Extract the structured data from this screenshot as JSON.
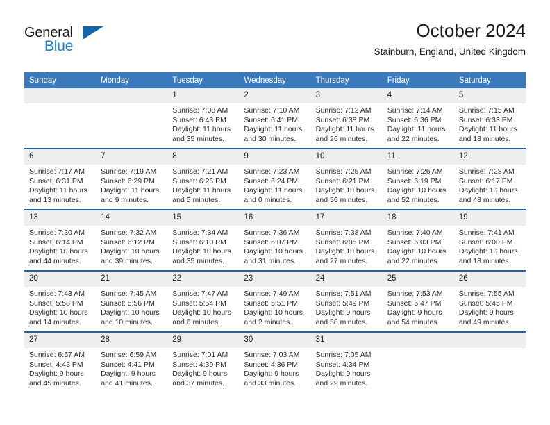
{
  "brand": {
    "name_dark": "General",
    "name_blue": "Blue",
    "accent_blue": "#1a7fd4",
    "triangle_blue": "#1565a8"
  },
  "header": {
    "title": "October 2024",
    "subtitle": "Stainburn, England, United Kingdom",
    "header_bg": "#3b79bd",
    "row_rule": "#1f63a8",
    "daynum_bg": "#eeeeee"
  },
  "weekdays": [
    "Sunday",
    "Monday",
    "Tuesday",
    "Wednesday",
    "Thursday",
    "Friday",
    "Saturday"
  ],
  "labels": {
    "sunrise_prefix": "Sunrise:",
    "sunset_prefix": "Sunset:",
    "daylight_prefix": "Daylight:"
  },
  "weeks": [
    [
      {
        "day": ""
      },
      {
        "day": ""
      },
      {
        "day": "1",
        "sunrise": "Sunrise: 7:08 AM",
        "sunset": "Sunset: 6:43 PM",
        "daylight_1": "Daylight: 11 hours",
        "daylight_2": "and 35 minutes."
      },
      {
        "day": "2",
        "sunrise": "Sunrise: 7:10 AM",
        "sunset": "Sunset: 6:41 PM",
        "daylight_1": "Daylight: 11 hours",
        "daylight_2": "and 30 minutes."
      },
      {
        "day": "3",
        "sunrise": "Sunrise: 7:12 AM",
        "sunset": "Sunset: 6:38 PM",
        "daylight_1": "Daylight: 11 hours",
        "daylight_2": "and 26 minutes."
      },
      {
        "day": "4",
        "sunrise": "Sunrise: 7:14 AM",
        "sunset": "Sunset: 6:36 PM",
        "daylight_1": "Daylight: 11 hours",
        "daylight_2": "and 22 minutes."
      },
      {
        "day": "5",
        "sunrise": "Sunrise: 7:15 AM",
        "sunset": "Sunset: 6:33 PM",
        "daylight_1": "Daylight: 11 hours",
        "daylight_2": "and 18 minutes."
      }
    ],
    [
      {
        "day": "6",
        "sunrise": "Sunrise: 7:17 AM",
        "sunset": "Sunset: 6:31 PM",
        "daylight_1": "Daylight: 11 hours",
        "daylight_2": "and 13 minutes."
      },
      {
        "day": "7",
        "sunrise": "Sunrise: 7:19 AM",
        "sunset": "Sunset: 6:29 PM",
        "daylight_1": "Daylight: 11 hours",
        "daylight_2": "and 9 minutes."
      },
      {
        "day": "8",
        "sunrise": "Sunrise: 7:21 AM",
        "sunset": "Sunset: 6:26 PM",
        "daylight_1": "Daylight: 11 hours",
        "daylight_2": "and 5 minutes."
      },
      {
        "day": "9",
        "sunrise": "Sunrise: 7:23 AM",
        "sunset": "Sunset: 6:24 PM",
        "daylight_1": "Daylight: 11 hours",
        "daylight_2": "and 0 minutes."
      },
      {
        "day": "10",
        "sunrise": "Sunrise: 7:25 AM",
        "sunset": "Sunset: 6:21 PM",
        "daylight_1": "Daylight: 10 hours",
        "daylight_2": "and 56 minutes."
      },
      {
        "day": "11",
        "sunrise": "Sunrise: 7:26 AM",
        "sunset": "Sunset: 6:19 PM",
        "daylight_1": "Daylight: 10 hours",
        "daylight_2": "and 52 minutes."
      },
      {
        "day": "12",
        "sunrise": "Sunrise: 7:28 AM",
        "sunset": "Sunset: 6:17 PM",
        "daylight_1": "Daylight: 10 hours",
        "daylight_2": "and 48 minutes."
      }
    ],
    [
      {
        "day": "13",
        "sunrise": "Sunrise: 7:30 AM",
        "sunset": "Sunset: 6:14 PM",
        "daylight_1": "Daylight: 10 hours",
        "daylight_2": "and 44 minutes."
      },
      {
        "day": "14",
        "sunrise": "Sunrise: 7:32 AM",
        "sunset": "Sunset: 6:12 PM",
        "daylight_1": "Daylight: 10 hours",
        "daylight_2": "and 39 minutes."
      },
      {
        "day": "15",
        "sunrise": "Sunrise: 7:34 AM",
        "sunset": "Sunset: 6:10 PM",
        "daylight_1": "Daylight: 10 hours",
        "daylight_2": "and 35 minutes."
      },
      {
        "day": "16",
        "sunrise": "Sunrise: 7:36 AM",
        "sunset": "Sunset: 6:07 PM",
        "daylight_1": "Daylight: 10 hours",
        "daylight_2": "and 31 minutes."
      },
      {
        "day": "17",
        "sunrise": "Sunrise: 7:38 AM",
        "sunset": "Sunset: 6:05 PM",
        "daylight_1": "Daylight: 10 hours",
        "daylight_2": "and 27 minutes."
      },
      {
        "day": "18",
        "sunrise": "Sunrise: 7:40 AM",
        "sunset": "Sunset: 6:03 PM",
        "daylight_1": "Daylight: 10 hours",
        "daylight_2": "and 22 minutes."
      },
      {
        "day": "19",
        "sunrise": "Sunrise: 7:41 AM",
        "sunset": "Sunset: 6:00 PM",
        "daylight_1": "Daylight: 10 hours",
        "daylight_2": "and 18 minutes."
      }
    ],
    [
      {
        "day": "20",
        "sunrise": "Sunrise: 7:43 AM",
        "sunset": "Sunset: 5:58 PM",
        "daylight_1": "Daylight: 10 hours",
        "daylight_2": "and 14 minutes."
      },
      {
        "day": "21",
        "sunrise": "Sunrise: 7:45 AM",
        "sunset": "Sunset: 5:56 PM",
        "daylight_1": "Daylight: 10 hours",
        "daylight_2": "and 10 minutes."
      },
      {
        "day": "22",
        "sunrise": "Sunrise: 7:47 AM",
        "sunset": "Sunset: 5:54 PM",
        "daylight_1": "Daylight: 10 hours",
        "daylight_2": "and 6 minutes."
      },
      {
        "day": "23",
        "sunrise": "Sunrise: 7:49 AM",
        "sunset": "Sunset: 5:51 PM",
        "daylight_1": "Daylight: 10 hours",
        "daylight_2": "and 2 minutes."
      },
      {
        "day": "24",
        "sunrise": "Sunrise: 7:51 AM",
        "sunset": "Sunset: 5:49 PM",
        "daylight_1": "Daylight: 9 hours",
        "daylight_2": "and 58 minutes."
      },
      {
        "day": "25",
        "sunrise": "Sunrise: 7:53 AM",
        "sunset": "Sunset: 5:47 PM",
        "daylight_1": "Daylight: 9 hours",
        "daylight_2": "and 54 minutes."
      },
      {
        "day": "26",
        "sunrise": "Sunrise: 7:55 AM",
        "sunset": "Sunset: 5:45 PM",
        "daylight_1": "Daylight: 9 hours",
        "daylight_2": "and 49 minutes."
      }
    ],
    [
      {
        "day": "27",
        "sunrise": "Sunrise: 6:57 AM",
        "sunset": "Sunset: 4:43 PM",
        "daylight_1": "Daylight: 9 hours",
        "daylight_2": "and 45 minutes."
      },
      {
        "day": "28",
        "sunrise": "Sunrise: 6:59 AM",
        "sunset": "Sunset: 4:41 PM",
        "daylight_1": "Daylight: 9 hours",
        "daylight_2": "and 41 minutes."
      },
      {
        "day": "29",
        "sunrise": "Sunrise: 7:01 AM",
        "sunset": "Sunset: 4:39 PM",
        "daylight_1": "Daylight: 9 hours",
        "daylight_2": "and 37 minutes."
      },
      {
        "day": "30",
        "sunrise": "Sunrise: 7:03 AM",
        "sunset": "Sunset: 4:36 PM",
        "daylight_1": "Daylight: 9 hours",
        "daylight_2": "and 33 minutes."
      },
      {
        "day": "31",
        "sunrise": "Sunrise: 7:05 AM",
        "sunset": "Sunset: 4:34 PM",
        "daylight_1": "Daylight: 9 hours",
        "daylight_2": "and 29 minutes."
      },
      {
        "day": ""
      },
      {
        "day": ""
      }
    ]
  ]
}
